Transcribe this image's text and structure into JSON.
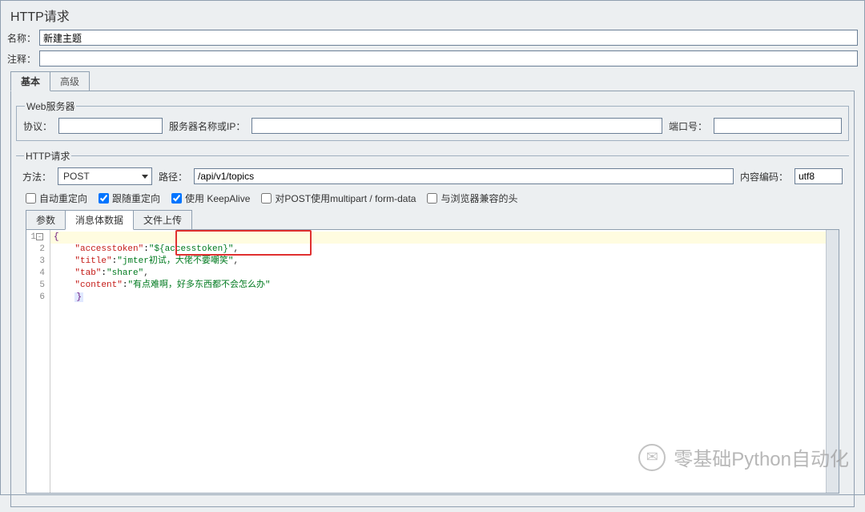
{
  "title": "HTTP请求",
  "fields": {
    "name_label": "名称：",
    "name_value": "新建主题",
    "comment_label": "注释：",
    "comment_value": ""
  },
  "tabs": {
    "basic": "基本",
    "advanced": "高级"
  },
  "webserver": {
    "legend": "Web服务器",
    "protocol_label": "协议：",
    "protocol_value": "",
    "server_label": "服务器名称或IP：",
    "server_value": "",
    "port_label": "端口号：",
    "port_value": ""
  },
  "httpreq": {
    "legend": "HTTP请求",
    "method_label": "方法：",
    "method_value": "POST",
    "path_label": "路径：",
    "path_value": "/api/v1/topics",
    "encoding_label": "内容编码：",
    "encoding_value": "utf8"
  },
  "checks": {
    "auto_redirect": "自动重定向",
    "follow_redirect": "跟随重定向",
    "keepalive": "使用 KeepAlive",
    "multipart": "对POST使用multipart / form-data",
    "browser_headers": "与浏览器兼容的头"
  },
  "subtabs": {
    "params": "参数",
    "body": "消息体数据",
    "upload": "文件上传"
  },
  "editor": {
    "line1": "{",
    "line2_key": "\"accesstoken\"",
    "line2_val": "\"${accesstoken}\"",
    "line3_key": "\"title\"",
    "line3_val": "\"jmter初试，大佬不要嘲笑\"",
    "line4_key": "\"tab\"",
    "line4_val": "\"share\"",
    "line5_key": "\"content\"",
    "line5_val": "\"有点难啊，好多东西都不会怎么办\"",
    "line6": "}"
  },
  "watermark_text": "零基础Python自动化"
}
